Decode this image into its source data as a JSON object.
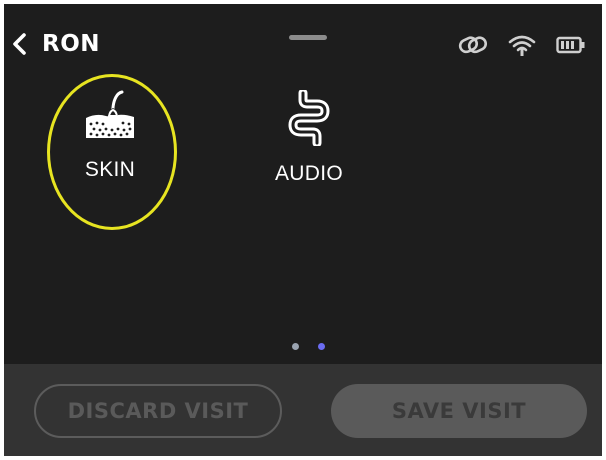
{
  "header": {
    "back_icon": "chevron-left-icon",
    "title": "RON"
  },
  "status_bar": {
    "icons": [
      "link-icon",
      "wifi-icon",
      "battery-icon"
    ]
  },
  "apps": [
    {
      "label": "SKIN",
      "icon": "skin-hair-icon",
      "selected": true
    },
    {
      "label": "AUDIO",
      "icon": "ear-canal-icon",
      "selected": false
    }
  ],
  "pager": {
    "total_pages": 2,
    "active_page": 2
  },
  "footer": {
    "discard_label": "DISCARD VISIT",
    "save_label": "SAVE VISIT"
  },
  "colors": {
    "background": "#1d1d1d",
    "footer_background": "#333333",
    "highlight": "#e7e421",
    "active_dot": "#6b6cf2",
    "inactive_dot": "#9aa3b0"
  }
}
